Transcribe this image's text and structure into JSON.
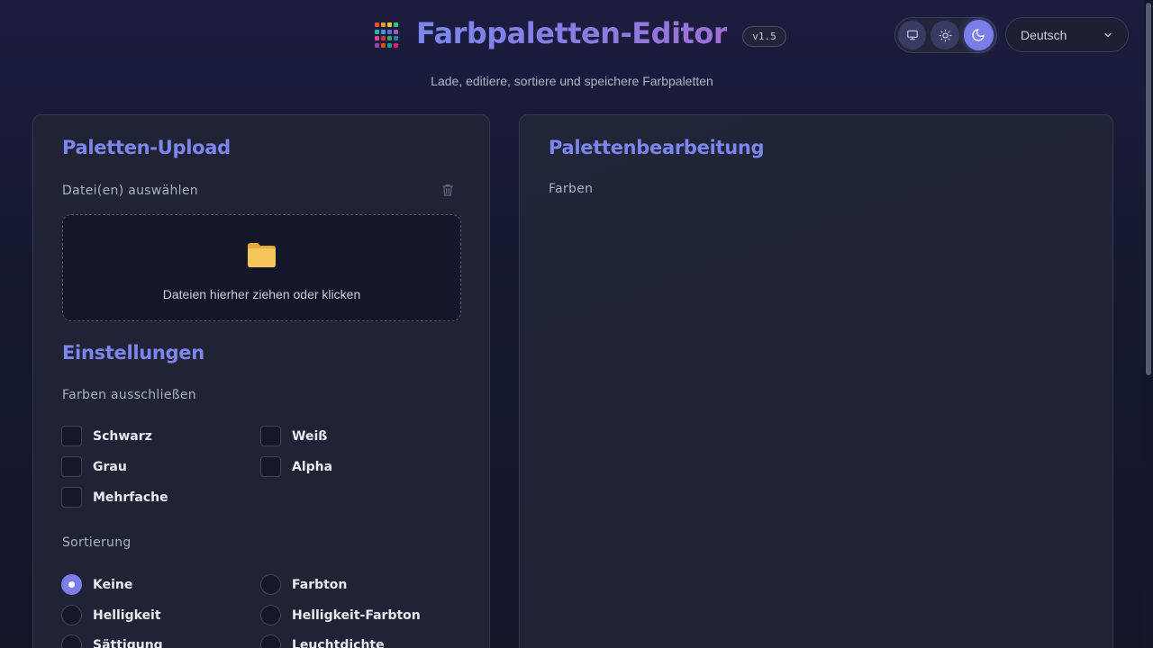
{
  "header": {
    "title": "Farbpaletten-Editor",
    "version": "v1.5",
    "subtitle": "Lade, editiere, sortiere und speichere Farbpaletten",
    "logo_icon": "color-grid-icon",
    "theme_buttons": [
      {
        "name": "system",
        "icon": "monitor-icon",
        "active": false
      },
      {
        "name": "light",
        "icon": "sun-icon",
        "active": false
      },
      {
        "name": "dark",
        "icon": "moon-icon",
        "active": true
      }
    ],
    "language": "Deutsch"
  },
  "upload": {
    "title": "Paletten-Upload",
    "file_label": "Datei(en) auswählen",
    "dropzone_text": "Dateien hierher ziehen oder klicken"
  },
  "settings": {
    "title": "Einstellungen",
    "exclude_label": "Farben ausschließen",
    "exclude_options": [
      "Schwarz",
      "Weiß",
      "Grau",
      "Alpha",
      "Mehrfache"
    ],
    "sort_label": "Sortierung",
    "sort_options": [
      "Keine",
      "Farbton",
      "Helligkeit",
      "Helligkeit-Farbton",
      "Sättigung",
      "Leuchtdichte"
    ],
    "sort_selected": "Keine"
  },
  "editor": {
    "title": "Palettenbearbeitung",
    "colors_label": "Farben"
  },
  "colors": {
    "accent": "#7b7ee8",
    "title_gradient_start": "#7b86ee",
    "title_gradient_end": "#9f6fd6",
    "background": "#151830",
    "panel": "#1f2334"
  }
}
